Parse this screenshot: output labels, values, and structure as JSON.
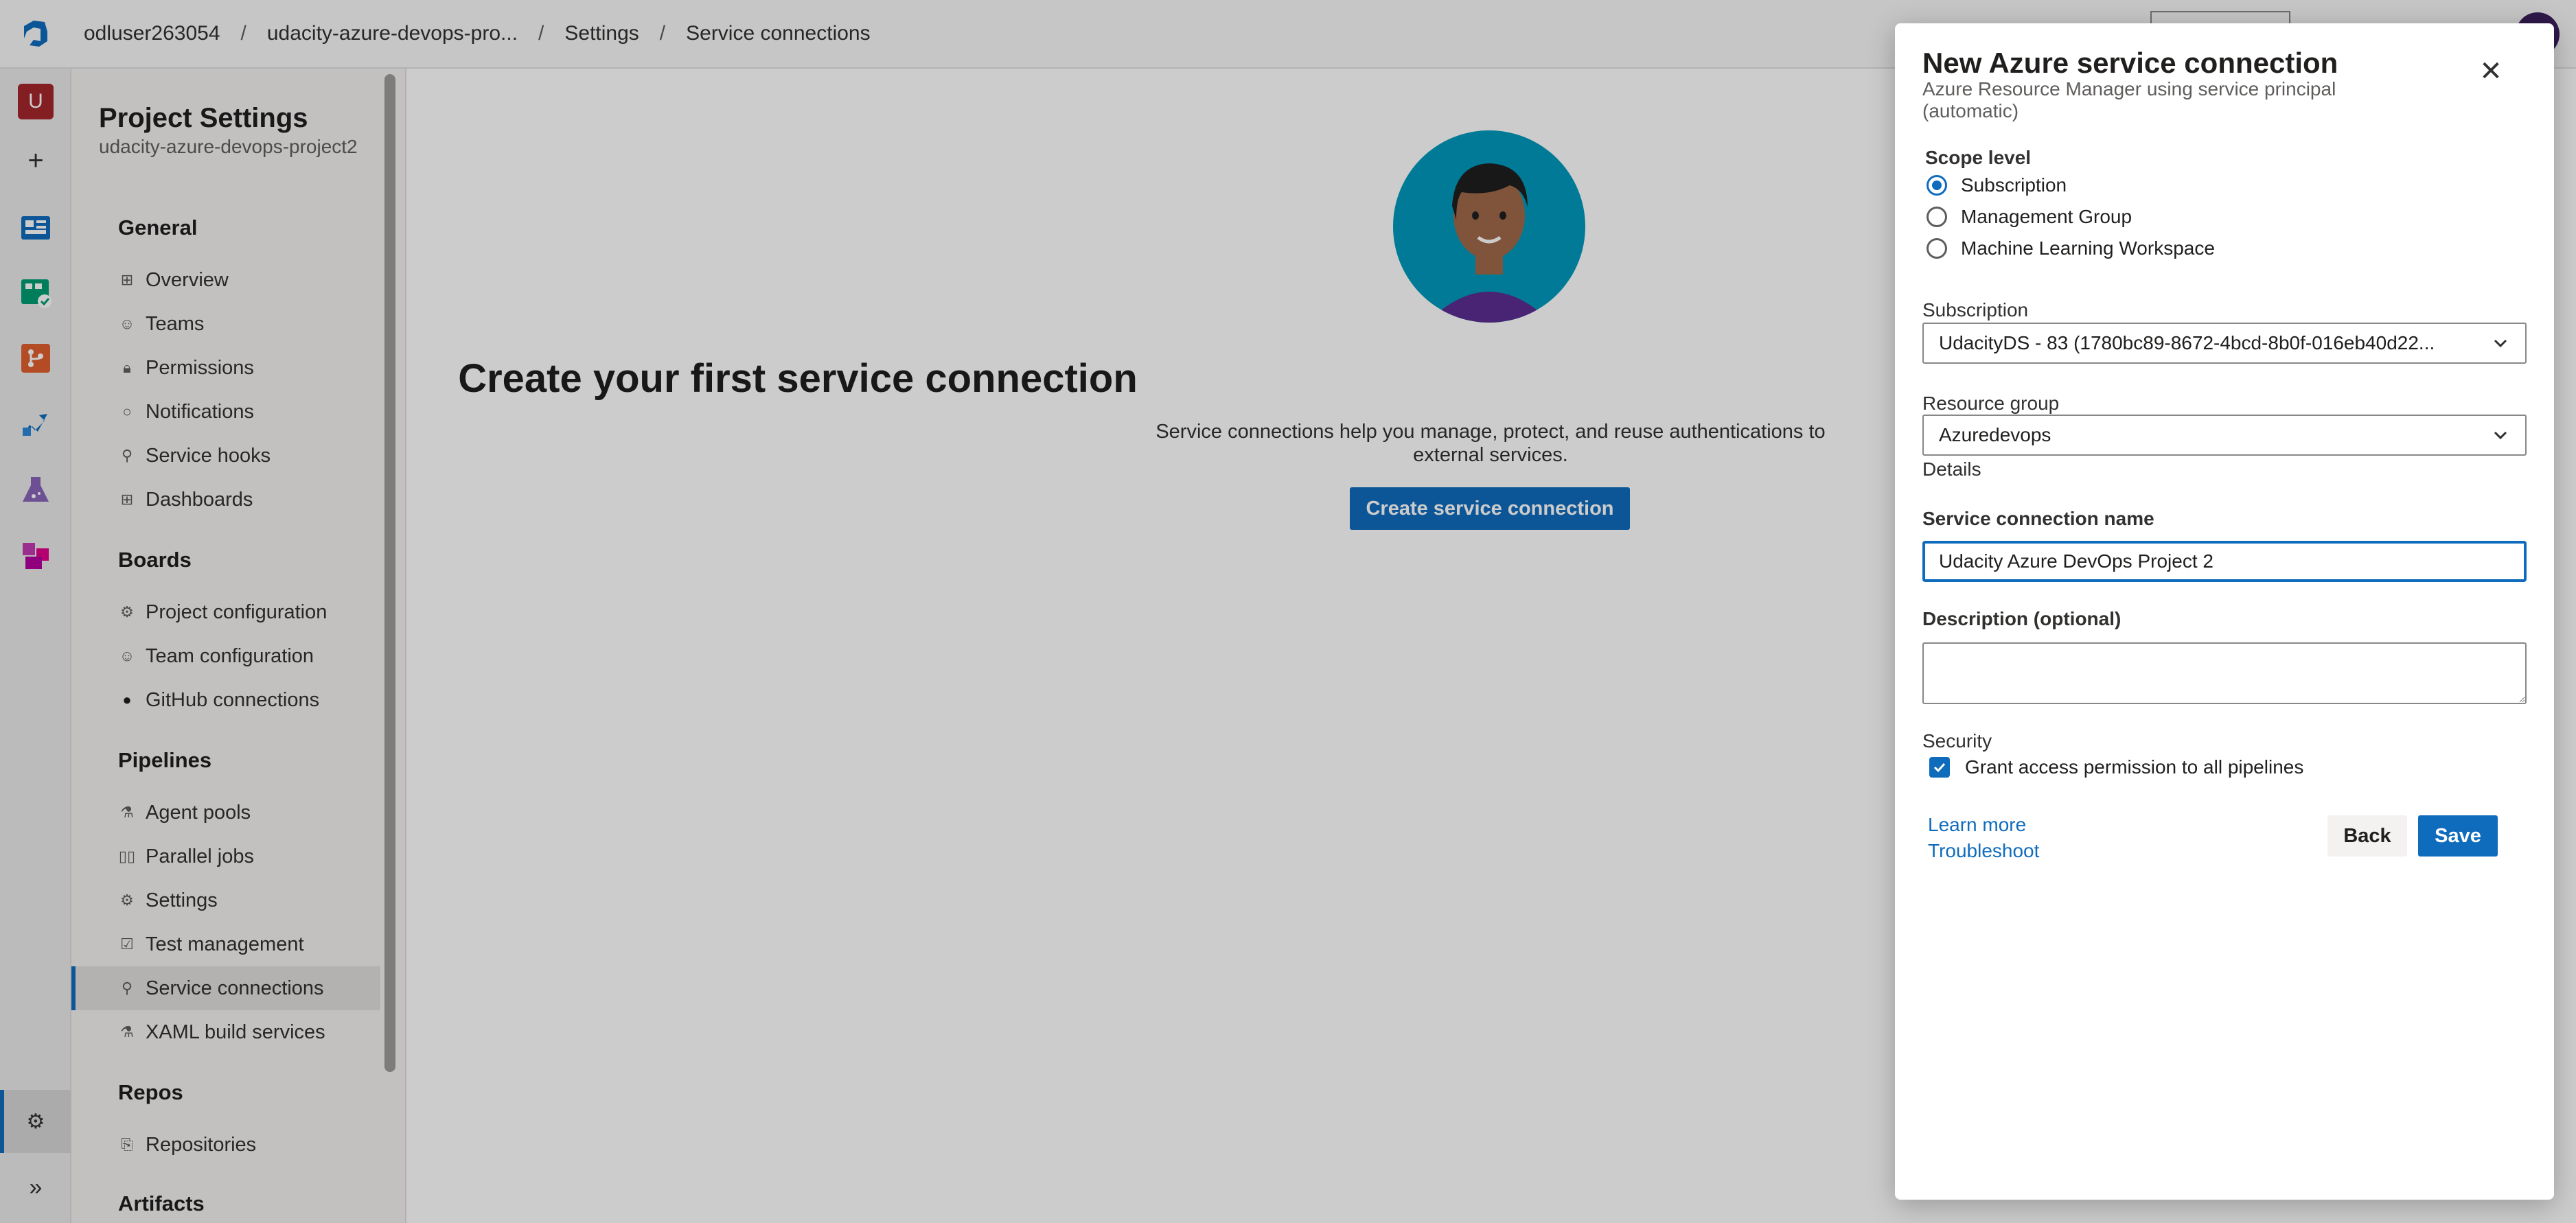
{
  "breadcrumb": {
    "org": "odluser263054",
    "project": "udacity-azure-devops-pro...",
    "settings": "Settings",
    "current": "Service connections",
    "separator": "/"
  },
  "rail": {
    "avatar_letter": "U",
    "add_symbol": "+",
    "expand_symbol": "»",
    "items": [
      "overview-icon",
      "boards-icon",
      "repos-icon",
      "pipelines-icon",
      "test-plans-icon",
      "artifacts-icon"
    ]
  },
  "settings_nav": {
    "title": "Project Settings",
    "project_name": "udacity-azure-devops-project2",
    "sections": {
      "general": "General",
      "boards": "Boards",
      "pipelines": "Pipelines",
      "repos": "Repos",
      "artifacts": "Artifacts"
    },
    "general_items": [
      "Overview",
      "Teams",
      "Permissions",
      "Notifications",
      "Service hooks",
      "Dashboards"
    ],
    "boards_items": [
      "Project configuration",
      "Team configuration",
      "GitHub connections"
    ],
    "pipelines_items": [
      "Agent pools",
      "Parallel jobs",
      "Settings",
      "Test management",
      "Service connections",
      "XAML build services"
    ],
    "repos_items": [
      "Repositories"
    ]
  },
  "main": {
    "title": "Create your first service connection",
    "description": "Service connections help you manage, protect, and reuse authentications to external services.",
    "create_button": "Create service connection"
  },
  "panel": {
    "title": "New Azure service connection",
    "subtitle": "Azure Resource Manager using service principal (automatic)",
    "scope_label": "Scope level",
    "scope_options": [
      "Subscription",
      "Management Group",
      "Machine Learning Workspace"
    ],
    "scope_selected": "Subscription",
    "subscription_label": "Subscription",
    "subscription_value": "UdacityDS - 83 (1780bc89-8672-4bcd-8b0f-016eb40d22...",
    "resource_group_label": "Resource group",
    "resource_group_value": "Azuredevops",
    "details_label": "Details",
    "connection_name_label": "Service connection name",
    "connection_name_value": "Udacity Azure DevOps Project 2",
    "description_label": "Description (optional)",
    "description_value": "",
    "security_label": "Security",
    "grant_access_label": "Grant access permission to all pipelines",
    "grant_access_checked": true,
    "learn_more": "Learn more",
    "troubleshoot": "Troubleshoot",
    "back_button": "Back",
    "save_button": "Save"
  },
  "colors": {
    "accent": "#0f6cbd",
    "panel_bg": "#ffffff",
    "overlay": "rgba(0,0,0,0.20)"
  }
}
